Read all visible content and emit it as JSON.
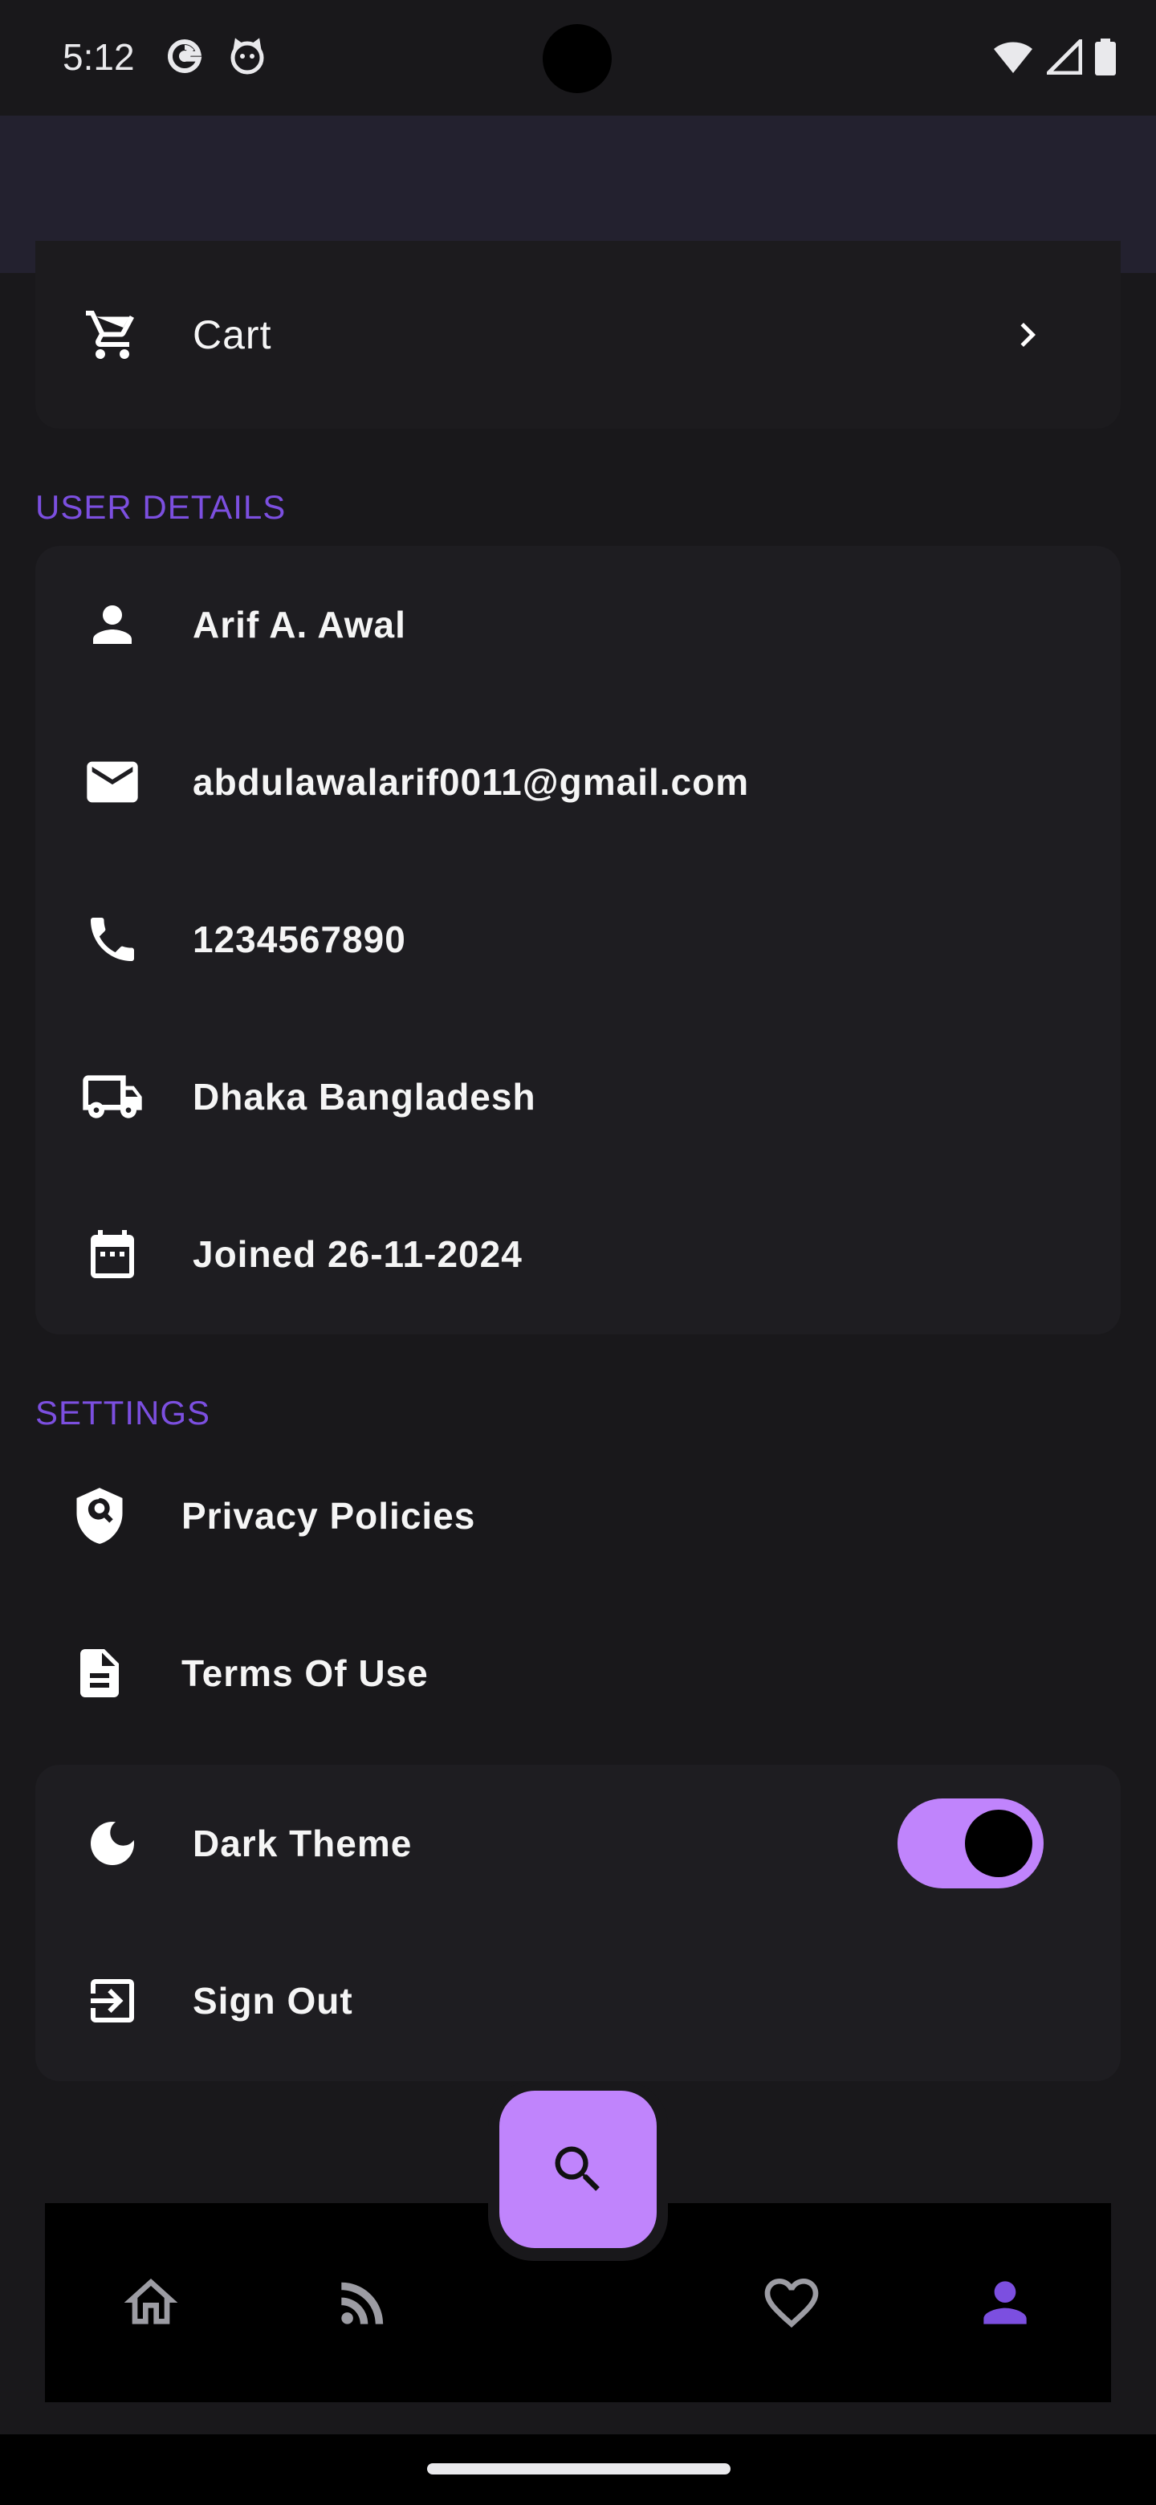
{
  "status_bar": {
    "time": "5:12",
    "icons": [
      "google-icon",
      "cat-notification-icon",
      "wifi-icon",
      "signal-icon",
      "battery-icon"
    ]
  },
  "cart": {
    "label": "Cart"
  },
  "user_details": {
    "section_title": "USER DETAILS",
    "items": [
      {
        "icon": "person-icon",
        "label": "Arif A. Awal"
      },
      {
        "icon": "email-icon",
        "label": "abdulawalarif0011@gmail.com"
      },
      {
        "icon": "phone-icon",
        "label": "1234567890"
      },
      {
        "icon": "truck-icon",
        "label": "Dhaka Bangladesh"
      },
      {
        "icon": "calendar-icon",
        "label": "Joined 26-11-2024"
      }
    ]
  },
  "settings": {
    "section_title": "SETTINGS",
    "privacy_label": "Privacy Policies",
    "terms_label": "Terms Of Use",
    "dark_theme_label": "Dark Theme",
    "dark_theme_enabled": true,
    "sign_out_label": "Sign Out"
  },
  "bottom_nav": {
    "items": [
      "home-icon",
      "feed-icon",
      "favorite-icon",
      "profile-icon"
    ],
    "active": "profile-icon",
    "fab_icon": "search-icon"
  },
  "colors": {
    "accent": "#7c4fe0",
    "toggle": "#c084fc",
    "background": "#19181b",
    "card": "#1e1d21"
  }
}
